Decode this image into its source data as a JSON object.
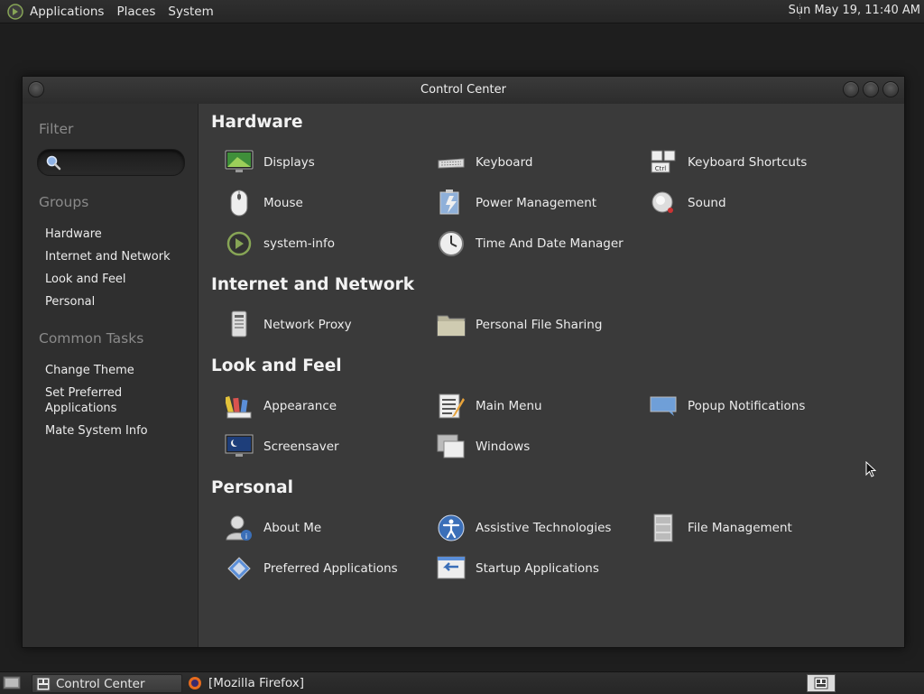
{
  "top_panel": {
    "menus": [
      "Applications",
      "Places",
      "System"
    ],
    "clock": "Sun May 19, 11:40 AM"
  },
  "window": {
    "title": "Control Center"
  },
  "sidebar": {
    "filter_heading": "Filter",
    "search_placeholder": "",
    "groups_heading": "Groups",
    "groups": [
      "Hardware",
      "Internet and Network",
      "Look and Feel",
      "Personal"
    ],
    "tasks_heading": "Common Tasks",
    "tasks": [
      "Change Theme",
      "Set Preferred Applications",
      "Mate System Info"
    ]
  },
  "sections": [
    {
      "title": "Hardware",
      "items": [
        {
          "label": "Displays",
          "icon": "display-icon"
        },
        {
          "label": "Keyboard",
          "icon": "keyboard-icon"
        },
        {
          "label": "Keyboard Shortcuts",
          "icon": "keyboard-shortcuts-icon"
        },
        {
          "label": "Mouse",
          "icon": "mouse-icon"
        },
        {
          "label": "Power Management",
          "icon": "power-management-icon"
        },
        {
          "label": "Sound",
          "icon": "sound-icon"
        },
        {
          "label": "system-info",
          "icon": "system-info-icon"
        },
        {
          "label": "Time And Date Manager",
          "icon": "clock-icon"
        }
      ]
    },
    {
      "title": "Internet and Network",
      "items": [
        {
          "label": "Network Proxy",
          "icon": "network-proxy-icon"
        },
        {
          "label": "Personal File Sharing",
          "icon": "folder-share-icon"
        }
      ]
    },
    {
      "title": "Look and Feel",
      "items": [
        {
          "label": "Appearance",
          "icon": "appearance-icon"
        },
        {
          "label": "Main Menu",
          "icon": "main-menu-icon"
        },
        {
          "label": "Popup Notifications",
          "icon": "notification-icon"
        },
        {
          "label": "Screensaver",
          "icon": "screensaver-icon"
        },
        {
          "label": "Windows",
          "icon": "windows-icon"
        }
      ]
    },
    {
      "title": "Personal",
      "items": [
        {
          "label": "About Me",
          "icon": "about-me-icon"
        },
        {
          "label": "Assistive Technologies",
          "icon": "accessibility-icon"
        },
        {
          "label": "File Management",
          "icon": "file-management-icon"
        },
        {
          "label": "Preferred Applications",
          "icon": "preferred-apps-icon"
        },
        {
          "label": "Startup Applications",
          "icon": "startup-apps-icon"
        }
      ]
    }
  ],
  "bottom_panel": {
    "tasks": [
      "Control Center",
      "[Mozilla Firefox]"
    ]
  }
}
